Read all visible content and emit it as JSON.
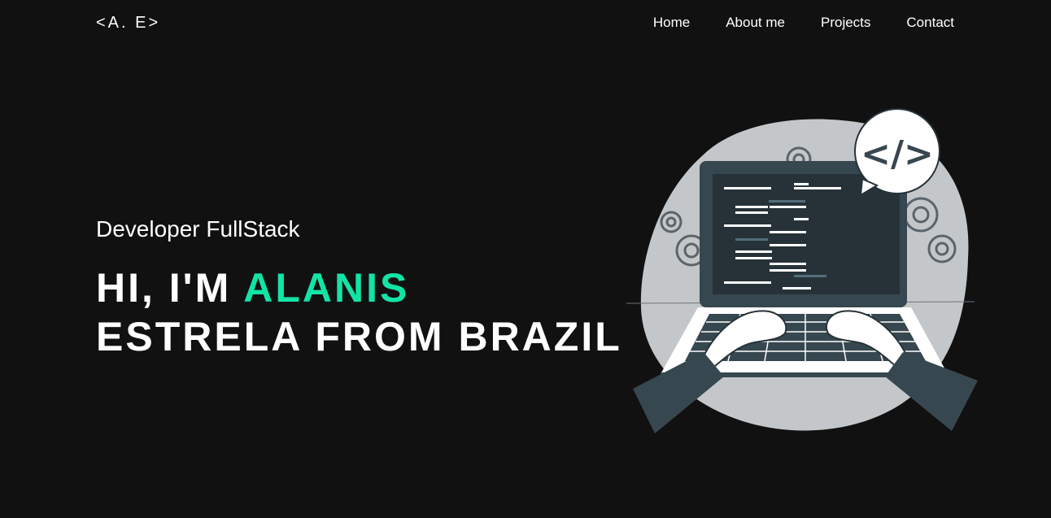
{
  "header": {
    "logo": "<A. E>",
    "nav": [
      {
        "label": "Home"
      },
      {
        "label": "About me"
      },
      {
        "label": "Projects"
      },
      {
        "label": "Contact"
      }
    ]
  },
  "hero": {
    "subtitle": "Developer FullStack",
    "headline_prefix": "HI, I'M ",
    "headline_name": "ALANIS",
    "headline_line2": "ESTRELA FROM BRAZIL"
  },
  "illustration": {
    "code_badge": "</>",
    "colors": {
      "blob": "#c4c7c9",
      "laptop": "#37474f",
      "screen": "#263238",
      "accent": "#12e4a6"
    }
  }
}
